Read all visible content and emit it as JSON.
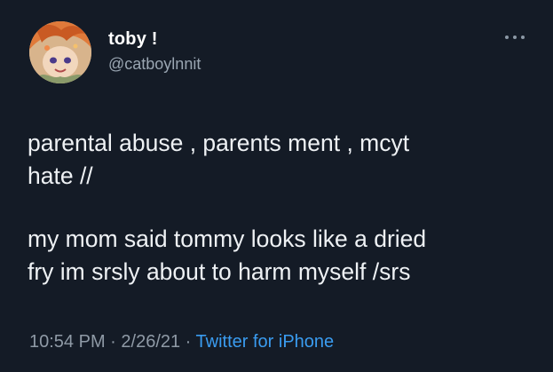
{
  "tweet": {
    "display_name": "toby !",
    "handle": "@catboylnnit",
    "paragraphs": [
      "parental abuse , parents ment , mcyt\nhate //",
      "my mom said tommy looks like a dried\nfry im srsly about to harm myself /srs"
    ],
    "time": "10:54 PM",
    "separator": " · ",
    "date": "2/26/21",
    "source": "Twitter for iPhone"
  },
  "icons": {
    "more": "more-options-icon",
    "avatar": "profile-avatar"
  },
  "colors": {
    "background": "#141b26",
    "text": "#eef1f4",
    "secondary_text": "#8f9aa6",
    "link": "#3a9cf0"
  }
}
